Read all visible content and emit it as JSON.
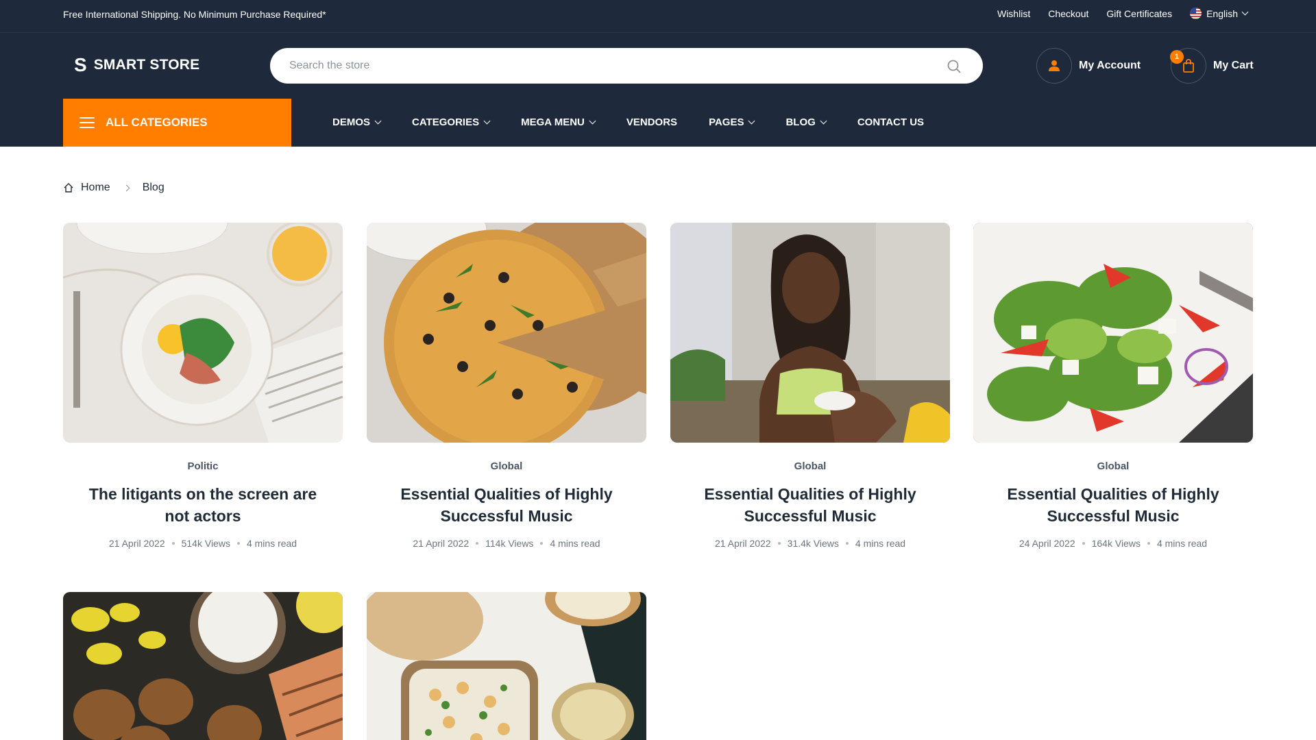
{
  "topbar": {
    "promo": "Free International Shipping. No Minimum Purchase Required*",
    "links": [
      "Wishlist",
      "Checkout",
      "Gift Certificates"
    ],
    "language": "English"
  },
  "header": {
    "logo_mark": "S",
    "logo_text": "SMART STORE",
    "search_placeholder": "Search the store",
    "account_label": "My Account",
    "cart_label": "My Cart",
    "cart_count": "1"
  },
  "nav": {
    "all_categories": "ALL CATEGORIES",
    "items": [
      {
        "label": "DEMOS",
        "dropdown": true
      },
      {
        "label": "CATEGORIES",
        "dropdown": true
      },
      {
        "label": "MEGA MENU",
        "dropdown": true
      },
      {
        "label": "VENDORS",
        "dropdown": false
      },
      {
        "label": "PAGES",
        "dropdown": true
      },
      {
        "label": "BLOG",
        "dropdown": true
      },
      {
        "label": "CONTACT US",
        "dropdown": false
      }
    ]
  },
  "breadcrumb": {
    "home": "Home",
    "current": "Blog"
  },
  "posts": [
    {
      "category": "Politic",
      "title": "The litigants on the screen are not actors",
      "date": "21 April 2022",
      "views": "514k Views",
      "read": "4 mins read"
    },
    {
      "category": "Global",
      "title": "Essential Qualities of Highly Successful Music",
      "date": "21 April 2022",
      "views": "114k Views",
      "read": "4 mins read"
    },
    {
      "category": "Global",
      "title": "Essential Qualities of Highly Successful Music",
      "date": "21 April 2022",
      "views": "31.4k Views",
      "read": "4 mins read"
    },
    {
      "category": "Global",
      "title": "Essential Qualities of Highly Successful Music",
      "date": "24 April 2022",
      "views": "164k Views",
      "read": "4 mins read"
    }
  ],
  "colors": {
    "dark": "#1e2a3b",
    "accent": "#ff7e00"
  }
}
